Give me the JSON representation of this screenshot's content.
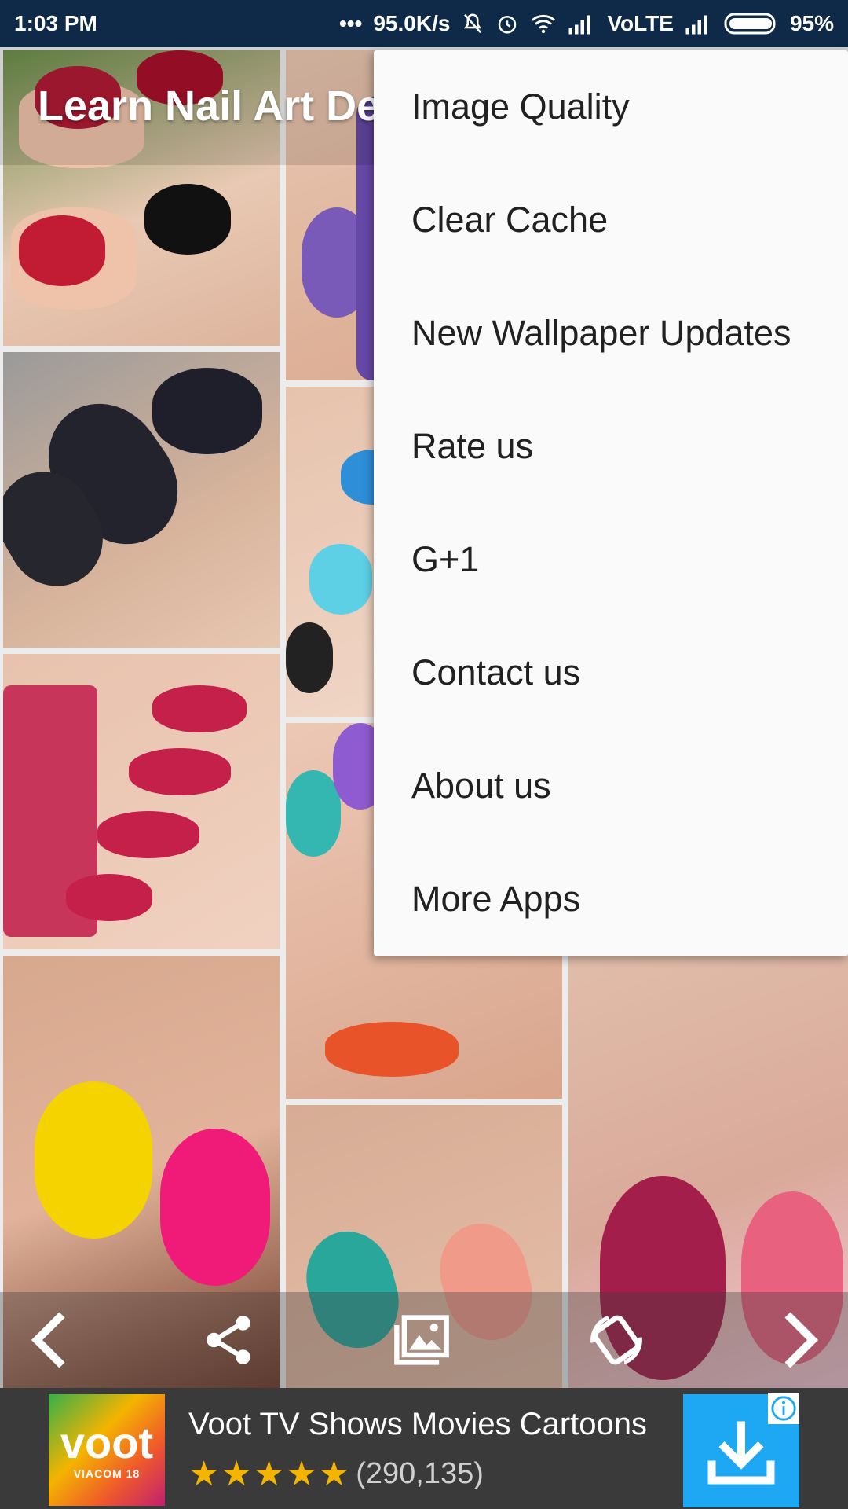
{
  "status_bar": {
    "time": "1:03 PM",
    "dots": "•••",
    "speed": "95.0K/s",
    "network": "VoLTE",
    "battery": "95%"
  },
  "app": {
    "title": "Learn Nail Art De"
  },
  "menu": {
    "items": [
      {
        "label": "Image Quality"
      },
      {
        "label": "Clear Cache"
      },
      {
        "label": "New Wallpaper Updates"
      },
      {
        "label": "Rate us"
      },
      {
        "label": "G+1"
      },
      {
        "label": "Contact us"
      },
      {
        "label": "About us"
      },
      {
        "label": "More Apps"
      }
    ]
  },
  "bottom_nav": {
    "icons": [
      "chevron-left-icon",
      "share-icon",
      "image-icon",
      "rotate-icon",
      "chevron-right-icon"
    ]
  },
  "ad": {
    "logo_text": "voot",
    "logo_subtext": "VIACOM 18",
    "title": "Voot TV Shows Movies Cartoons",
    "stars": "★★★★★",
    "rating_value": 4.5,
    "rating_count": "(290,135)",
    "install_color": "#1ea7f2"
  },
  "colors": {
    "status_bar": "#0e2a48",
    "menu_bg": "#fafafa",
    "menu_text": "#212121"
  }
}
